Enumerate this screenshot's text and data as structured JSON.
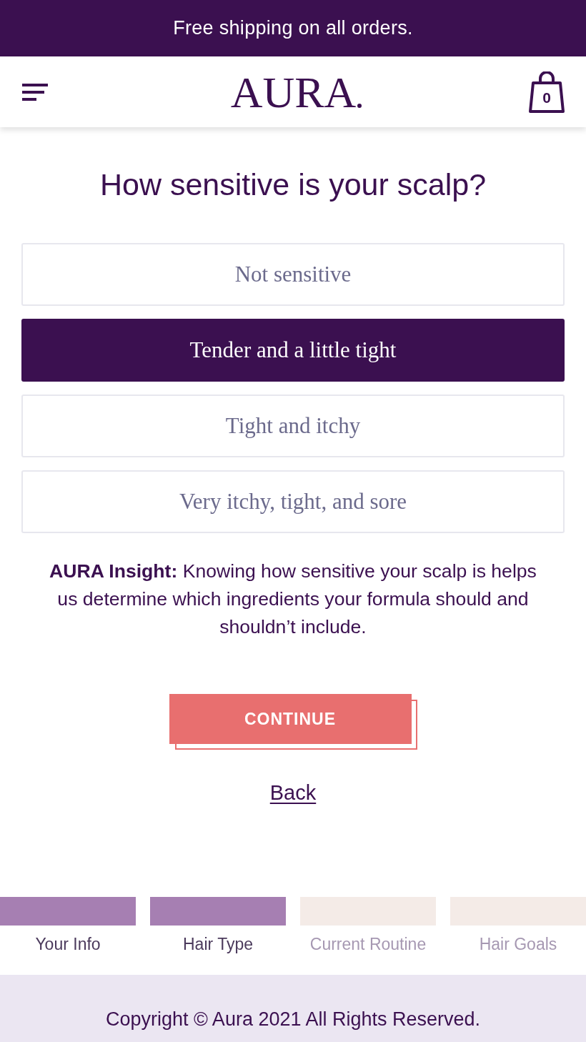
{
  "banner": {
    "text": "Free shipping on all orders."
  },
  "header": {
    "logo": "AURA",
    "cart_count": "0"
  },
  "question": "How sensitive is your scalp?",
  "options": [
    {
      "label": "Not sensitive",
      "selected": false
    },
    {
      "label": "Tender and a little tight",
      "selected": true
    },
    {
      "label": "Tight and itchy",
      "selected": false
    },
    {
      "label": "Very itchy, tight, and sore",
      "selected": false
    }
  ],
  "insight": "**AURA Insight:** Knowing how sensitive your scalp is helps us determine which ingredients your formula should and shouldn’t include.",
  "continue_button": "CONTINUE",
  "back_link": "Back",
  "progress": [
    {
      "label": "Your Info",
      "completed": true
    },
    {
      "label": "Hair Type",
      "completed": true
    },
    {
      "label": "Current Routine",
      "completed": false
    },
    {
      "label": "Hair Goals",
      "completed": false
    }
  ],
  "footer": {
    "text": "Copyright © Aura 2021 All Rights Reserved."
  }
}
